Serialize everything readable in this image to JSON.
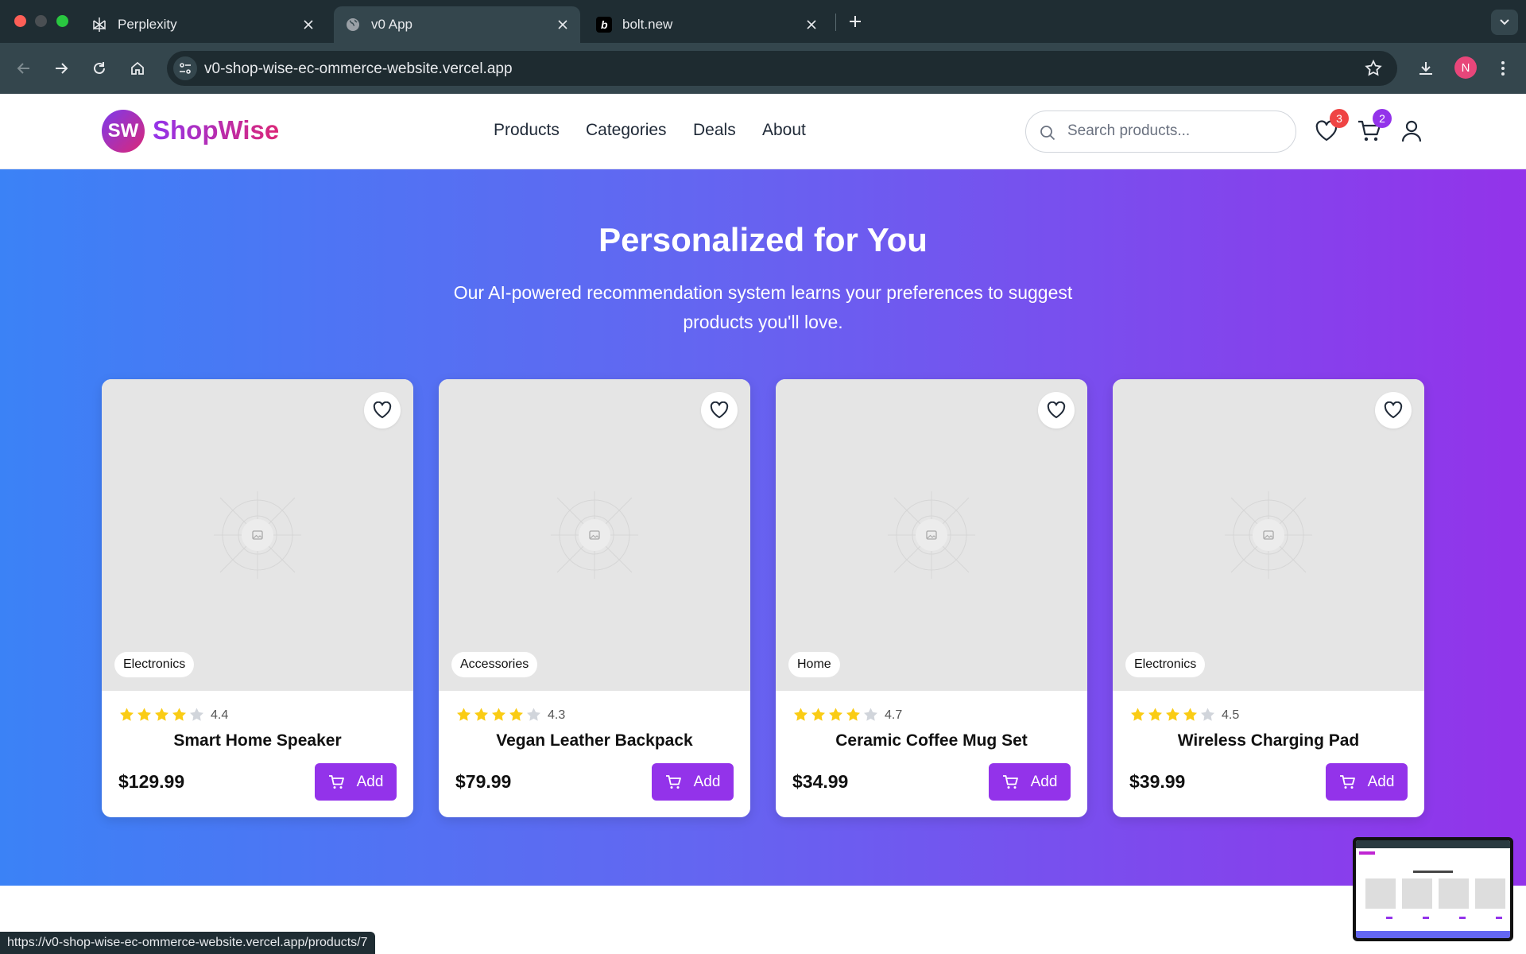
{
  "browser": {
    "tabs": [
      {
        "title": "Perplexity",
        "icon": "perplexity-icon",
        "active": false
      },
      {
        "title": "v0 App",
        "icon": "globe-icon",
        "active": true
      },
      {
        "title": "bolt.new",
        "icon": "bolt-icon",
        "active": false
      }
    ],
    "url": "v0-shop-wise-ec-ommerce-website.vercel.app",
    "profile_initial": "N",
    "status_url": "https://v0-shop-wise-ec-ommerce-website.vercel.app/products/7"
  },
  "header": {
    "logo_initials": "SW",
    "logo_text": "ShopWise",
    "nav": [
      "Products",
      "Categories",
      "Deals",
      "About"
    ],
    "search_placeholder": "Search products...",
    "wishlist_count": "3",
    "cart_count": "2"
  },
  "hero": {
    "title": "Personalized for You",
    "subtitle": "Our AI-powered recommendation system learns your preferences to suggest products you'll love."
  },
  "products": [
    {
      "category": "Electronics",
      "rating": "4.4",
      "stars": 4,
      "name": "Smart Home Speaker",
      "price": "$129.99",
      "add_label": "Add"
    },
    {
      "category": "Accessories",
      "rating": "4.3",
      "stars": 4,
      "name": "Vegan Leather Backpack",
      "price": "$79.99",
      "add_label": "Add"
    },
    {
      "category": "Home",
      "rating": "4.7",
      "stars": 4,
      "name": "Ceramic Coffee Mug Set",
      "price": "$34.99",
      "add_label": "Add"
    },
    {
      "category": "Electronics",
      "rating": "4.5",
      "stars": 4,
      "name": "Wireless Charging Pad",
      "price": "$39.99",
      "add_label": "Add"
    }
  ],
  "colors": {
    "brand_purple": "#9333ea",
    "brand_pink": "#db2777",
    "hero_start": "#3b82f6",
    "hero_end": "#9333ea",
    "wishlist_badge": "#ef4444",
    "cart_badge": "#9333ea",
    "star": "#facc15"
  }
}
